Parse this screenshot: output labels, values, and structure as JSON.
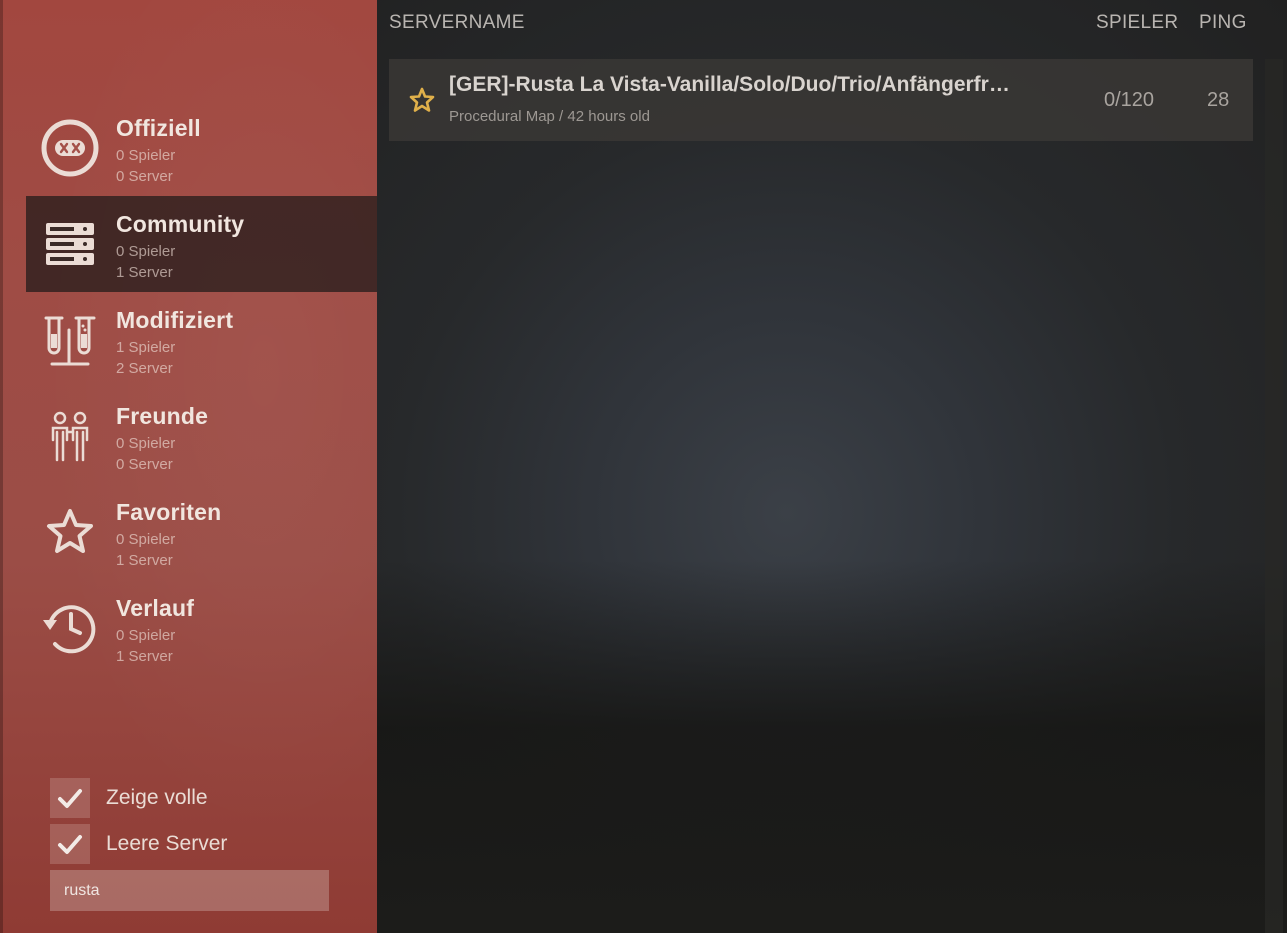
{
  "sidebar": {
    "categories": [
      {
        "name": "Offiziell",
        "players": "0 Spieler",
        "servers": "0 Server",
        "icon": "rust-logo-icon",
        "active": false
      },
      {
        "name": "Community",
        "players": "0 Spieler",
        "servers": "1 Server",
        "icon": "server-rack-icon",
        "active": true
      },
      {
        "name": "Modifiziert",
        "players": "1 Spieler",
        "servers": "2 Server",
        "icon": "test-tubes-icon",
        "active": false
      },
      {
        "name": "Freunde",
        "players": "0 Spieler",
        "servers": "0 Server",
        "icon": "friends-icon",
        "active": false
      },
      {
        "name": "Favoriten",
        "players": "0 Spieler",
        "servers": "1 Server",
        "icon": "star-icon",
        "active": false
      },
      {
        "name": "Verlauf",
        "players": "0 Spieler",
        "servers": "1 Server",
        "icon": "history-icon",
        "active": false
      }
    ],
    "filters": {
      "show_full": {
        "label": "Zeige volle",
        "checked": true
      },
      "empty_servers": {
        "label": "Leere Server",
        "checked": true
      }
    },
    "search": {
      "value": "rusta",
      "placeholder": ""
    }
  },
  "list": {
    "headers": {
      "name": "SERVERNAME",
      "players": "SPIELER",
      "ping": "PING"
    },
    "servers": [
      {
        "title": "[GER]-Rusta La Vista-Vanilla/Solo/Duo/Trio/Anfängerfre…",
        "meta": "Procedural Map / 42 hours old",
        "players": "0/120",
        "ping": "28",
        "favorite": true
      }
    ]
  },
  "colors": {
    "sidebar_bg": "#9f4c45",
    "active_bg": "#2a1e1c",
    "favorite_star": "#e0b04a",
    "text_light": "#f1e6df"
  }
}
